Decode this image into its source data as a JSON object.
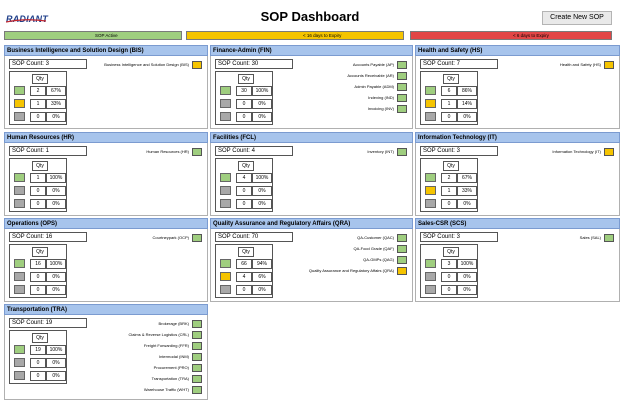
{
  "header": {
    "logo_text": "RADIANT",
    "title": "SOP Dashboard",
    "new_sop_button": "Create New SOP"
  },
  "legend": {
    "active": "SOP Active",
    "warning": "< 16 days to Expiry",
    "expired": "< 6 days to Expiry"
  },
  "colors": {
    "green": "#9fce7f",
    "yellow": "#f5c400",
    "grey": "#a8a8a8",
    "red": "#e24646",
    "header_blue": "#a7c4ec"
  },
  "qty_header": "Qty",
  "sections": [
    {
      "title": "Business Intelligence and Solution Design (BIS)",
      "count": "SOP Count: 3",
      "rows": [
        {
          "status": "green",
          "qty": "2",
          "pct": "67%"
        },
        {
          "status": "yellow",
          "qty": "1",
          "pct": "33%"
        },
        {
          "status": "grey",
          "qty": "0",
          "pct": "0%"
        }
      ],
      "subs": [
        {
          "label": "Business Intelligence and Solution Design (BIS)",
          "status": "yellow"
        }
      ]
    },
    {
      "title": "Finance-Admin (FIN)",
      "count": "SOP Count: 30",
      "rows": [
        {
          "status": "green",
          "qty": "30",
          "pct": "100%"
        },
        {
          "status": "grey",
          "qty": "0",
          "pct": "0%"
        },
        {
          "status": "grey",
          "qty": "0",
          "pct": "0%"
        }
      ],
      "subs": [
        {
          "label": "Accounts Payable (AP)",
          "status": "green"
        },
        {
          "label": "Accounts Receivable (AR)",
          "status": "green"
        },
        {
          "label": "Admin Payable (ADM)",
          "status": "green"
        },
        {
          "label": "Indexing (IND)",
          "status": "green"
        },
        {
          "label": "Invoicing (INV)",
          "status": "green"
        }
      ]
    },
    {
      "title": "Health and Safety (HS)",
      "count": "SOP Count: 7",
      "rows": [
        {
          "status": "green",
          "qty": "6",
          "pct": "86%"
        },
        {
          "status": "yellow",
          "qty": "1",
          "pct": "14%"
        },
        {
          "status": "grey",
          "qty": "0",
          "pct": "0%"
        }
      ],
      "subs": [
        {
          "label": "Health and Safety (HS)",
          "status": "yellow"
        }
      ]
    },
    {
      "title": "Human Resources (HR)",
      "count": "SOP Count: 1",
      "rows": [
        {
          "status": "green",
          "qty": "1",
          "pct": "100%"
        },
        {
          "status": "grey",
          "qty": "0",
          "pct": "0%"
        },
        {
          "status": "grey",
          "qty": "0",
          "pct": "0%"
        }
      ],
      "subs": [
        {
          "label": "Human Resources (HR)",
          "status": "green"
        }
      ]
    },
    {
      "title": "Facilities (FCL)",
      "count": "SOP Count: 4",
      "rows": [
        {
          "status": "green",
          "qty": "4",
          "pct": "100%"
        },
        {
          "status": "grey",
          "qty": "0",
          "pct": "0%"
        },
        {
          "status": "grey",
          "qty": "0",
          "pct": "0%"
        }
      ],
      "subs": [
        {
          "label": "Inventory (INT)",
          "status": "green"
        }
      ]
    },
    {
      "title": "Information Technology (IT)",
      "count": "SOP Count: 3",
      "rows": [
        {
          "status": "green",
          "qty": "2",
          "pct": "67%"
        },
        {
          "status": "yellow",
          "qty": "1",
          "pct": "33%"
        },
        {
          "status": "grey",
          "qty": "0",
          "pct": "0%"
        }
      ],
      "subs": [
        {
          "label": "Information Technology (IT)",
          "status": "yellow"
        }
      ]
    },
    {
      "title": "Operations (OPS)",
      "count": "SOP Count: 16",
      "rows": [
        {
          "status": "green",
          "qty": "16",
          "pct": "100%"
        },
        {
          "status": "grey",
          "qty": "0",
          "pct": "0%"
        },
        {
          "status": "grey",
          "qty": "0",
          "pct": "0%"
        }
      ],
      "subs": [
        {
          "label": "Courtneypark (OCP)",
          "status": "green"
        }
      ]
    },
    {
      "title": "Quality Assurance and Regulatory Affairs (QRA)",
      "count": "SOP Count: 70",
      "rows": [
        {
          "status": "green",
          "qty": "66",
          "pct": "94%"
        },
        {
          "status": "yellow",
          "qty": "4",
          "pct": "6%"
        },
        {
          "status": "grey",
          "qty": "0",
          "pct": "0%"
        }
      ],
      "subs": [
        {
          "label": "QA-Customer (QAC)",
          "status": "green"
        },
        {
          "label": "QA-Food Grade (QAF)",
          "status": "green"
        },
        {
          "label": "QA-GMPs (QAG)",
          "status": "green"
        },
        {
          "label": "Quality Assurance and Regulatory Affairs (QRA)",
          "status": "yellow"
        }
      ]
    },
    {
      "title": "Sales-CSR (SCS)",
      "count": "SOP Count: 3",
      "rows": [
        {
          "status": "green",
          "qty": "3",
          "pct": "100%"
        },
        {
          "status": "grey",
          "qty": "0",
          "pct": "0%"
        },
        {
          "status": "grey",
          "qty": "0",
          "pct": "0%"
        }
      ],
      "subs": [
        {
          "label": "Sales (SAL)",
          "status": "green"
        }
      ]
    },
    {
      "title": "Transportation (TRA)",
      "count": "SOP Count: 19",
      "rows": [
        {
          "status": "green",
          "qty": "19",
          "pct": "100%"
        },
        {
          "status": "grey",
          "qty": "0",
          "pct": "0%"
        },
        {
          "status": "grey",
          "qty": "0",
          "pct": "0%"
        }
      ],
      "subs": [
        {
          "label": "Brokerage (BRK)",
          "status": "green"
        },
        {
          "label": "Claims & Reverse Logistics (CRL)",
          "status": "green"
        },
        {
          "label": "Freight Forwarding (FFR)",
          "status": "green"
        },
        {
          "label": "Intermodal (INM)",
          "status": "green"
        },
        {
          "label": "Procurement (PRO)",
          "status": "green"
        },
        {
          "label": "Transportation (TRA)",
          "status": "green"
        },
        {
          "label": "Warehouse Traffic (WHT)",
          "status": "green"
        }
      ]
    }
  ]
}
